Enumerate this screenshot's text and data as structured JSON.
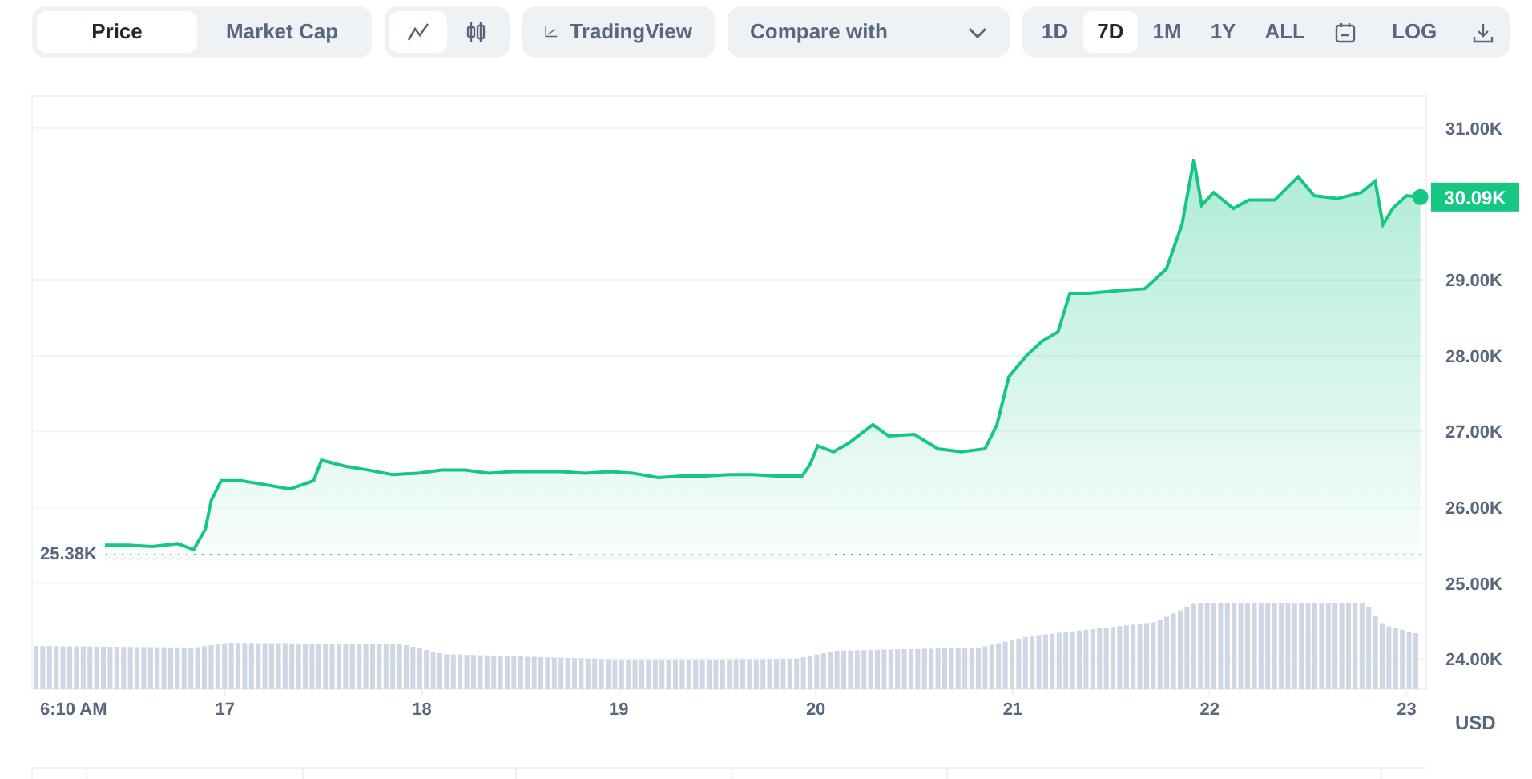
{
  "toolbar": {
    "view_toggle": [
      {
        "label": "Price",
        "selected": true
      },
      {
        "label": "Market Cap",
        "selected": false
      }
    ],
    "chart_type": [
      {
        "kind": "line",
        "selected": true
      },
      {
        "kind": "candle",
        "selected": false
      }
    ],
    "tradingview": {
      "label": "TradingView"
    },
    "compare": {
      "label": "Compare with"
    },
    "ranges": [
      {
        "label": "1D",
        "selected": false
      },
      {
        "label": "7D",
        "selected": true
      },
      {
        "label": "1M",
        "selected": false
      },
      {
        "label": "1Y",
        "selected": false
      },
      {
        "label": "ALL",
        "selected": false
      }
    ],
    "log": {
      "label": "LOG",
      "selected": false
    }
  },
  "chart": {
    "start_time": "6:10 AM",
    "open_price": "25.38K",
    "currency": "USD",
    "chart_data": {
      "type": "area",
      "x": [
        16.39,
        16.51,
        16.63,
        16.76,
        16.84,
        16.9,
        16.93,
        16.98,
        17.08,
        17.2,
        17.33,
        17.45,
        17.49,
        17.61,
        17.73,
        17.85,
        17.98,
        18.1,
        18.22,
        18.34,
        18.46,
        18.59,
        18.71,
        18.83,
        18.95,
        19.07,
        19.2,
        19.32,
        19.44,
        19.56,
        19.68,
        19.8,
        19.93,
        19.97,
        20.01,
        20.09,
        20.17,
        20.29,
        20.37,
        20.5,
        20.62,
        20.74,
        20.86,
        20.92,
        20.98,
        21.07,
        21.15,
        21.23,
        21.29,
        21.39,
        21.55,
        21.67,
        21.78,
        21.86,
        21.92,
        21.96,
        22.02,
        22.12,
        22.2,
        22.33,
        22.45,
        22.53,
        22.65,
        22.77,
        22.84,
        22.88,
        22.93,
        23.0,
        23.07
      ],
      "series": [
        {
          "color": "#16c784",
          "values": [
            25.5,
            25.5,
            25.48,
            25.52,
            25.44,
            25.71,
            26.09,
            26.35,
            26.35,
            26.3,
            26.24,
            26.35,
            26.62,
            26.54,
            26.49,
            26.43,
            26.45,
            26.49,
            26.49,
            26.45,
            26.47,
            26.47,
            26.47,
            26.45,
            26.47,
            26.45,
            26.39,
            26.41,
            26.41,
            26.43,
            26.43,
            26.41,
            26.41,
            26.56,
            26.81,
            26.73,
            26.85,
            27.09,
            26.94,
            26.96,
            26.77,
            26.73,
            26.77,
            27.09,
            27.72,
            28.0,
            28.19,
            28.31,
            28.82,
            28.82,
            28.86,
            28.88,
            29.14,
            29.73,
            30.58,
            29.98,
            30.15,
            29.94,
            30.05,
            30.05,
            30.36,
            30.11,
            30.07,
            30.15,
            30.3,
            29.73,
            29.94,
            30.11,
            30.09
          ]
        }
      ],
      "xlim": [
        16.02,
        23.1
      ],
      "ylim": [
        23.6,
        31.42
      ],
      "grid": true,
      "xticks": [
        17,
        18,
        19,
        20,
        21,
        22,
        23
      ],
      "yticks": [
        {
          "value": 24,
          "label": "24.00K"
        },
        {
          "value": 25,
          "label": "25.00K"
        },
        {
          "value": 26,
          "label": "26.00K"
        },
        {
          "value": 27,
          "label": "27.00K"
        },
        {
          "value": 28,
          "label": "28.00K"
        },
        {
          "value": 29,
          "label": "29.00K"
        },
        {
          "value": 31,
          "label": "31.00K"
        }
      ],
      "annotations": [
        {
          "x": 23.07,
          "y": 30.09,
          "text": "30.09K"
        }
      ]
    }
  }
}
